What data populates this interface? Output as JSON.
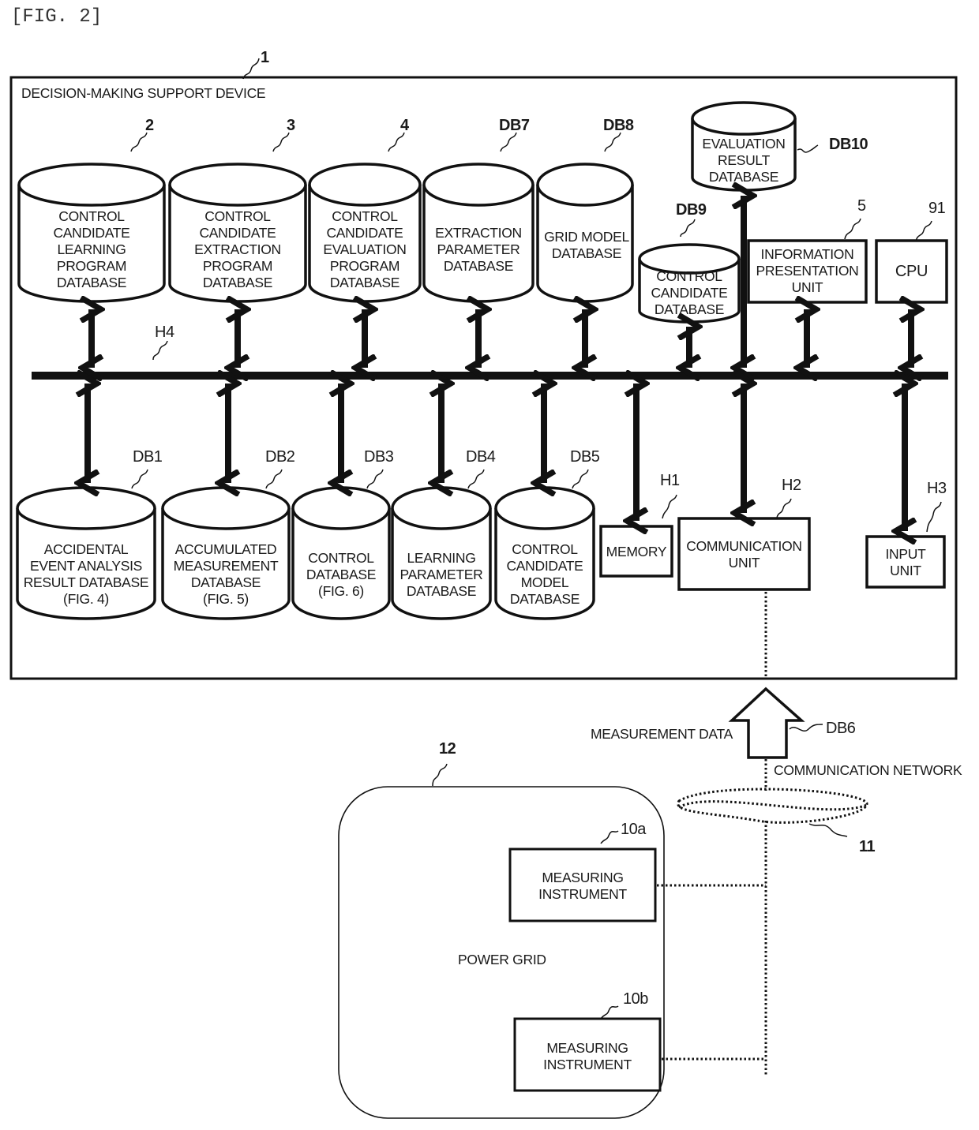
{
  "figure_label": "[FIG. 2]",
  "device": {
    "ref": "1",
    "title": "DECISION-MAKING SUPPORT DEVICE",
    "bus_ref": "H4"
  },
  "top_databases": [
    {
      "ref": "2",
      "label": "CONTROL\nCANDIDATE\nLEARNING\nPROGRAM\nDATABASE"
    },
    {
      "ref": "3",
      "label": "CONTROL\nCANDIDATE\nEXTRACTION\nPROGRAM\nDATABASE"
    },
    {
      "ref": "4",
      "label": "CONTROL\nCANDIDATE\nEVALUATION\nPROGRAM\nDATABASE"
    },
    {
      "ref": "DB7",
      "label": "EXTRACTION\nPARAMETER\nDATABASE"
    },
    {
      "ref": "DB8",
      "label": "GRID MODEL\nDATABASE"
    },
    {
      "ref": "DB9",
      "label": "CONTROL\nCANDIDATE\nDATABASE"
    },
    {
      "ref": "DB10",
      "label": "EVALUATION\nRESULT\nDATABASE"
    }
  ],
  "top_units": [
    {
      "ref": "5",
      "label": "INFORMATION\nPRESENTATION\nUNIT"
    },
    {
      "ref": "91",
      "label": "CPU"
    }
  ],
  "bottom_databases": [
    {
      "ref": "DB1",
      "label": "ACCIDENTAL\nEVENT ANALYSIS\nRESULT DATABASE\n(FIG. 4)"
    },
    {
      "ref": "DB2",
      "label": "ACCUMULATED\nMEASUREMENT\nDATABASE\n(FIG. 5)"
    },
    {
      "ref": "DB3",
      "label": "CONTROL\nDATABASE\n(FIG. 6)"
    },
    {
      "ref": "DB4",
      "label": "LEARNING\nPARAMETER\nDATABASE"
    },
    {
      "ref": "DB5",
      "label": "CONTROL\nCANDIDATE\nMODEL\nDATABASE"
    }
  ],
  "bottom_units": [
    {
      "ref": "H1",
      "label": "MEMORY"
    },
    {
      "ref": "H2",
      "label": "COMMUNICATION\nUNIT"
    },
    {
      "ref": "H3",
      "label": "INPUT\nUNIT"
    }
  ],
  "measurement": {
    "label": "MEASUREMENT DATA",
    "ref": "DB6"
  },
  "network": {
    "label": "COMMUNICATION NETWORK",
    "ref": "11"
  },
  "power_grid": {
    "ref": "12",
    "label": "POWER GRID",
    "instruments": [
      {
        "ref": "10a",
        "label": "MEASURING\nINSTRUMENT"
      },
      {
        "ref": "10b",
        "label": "MEASURING\nINSTRUMENT"
      }
    ]
  }
}
